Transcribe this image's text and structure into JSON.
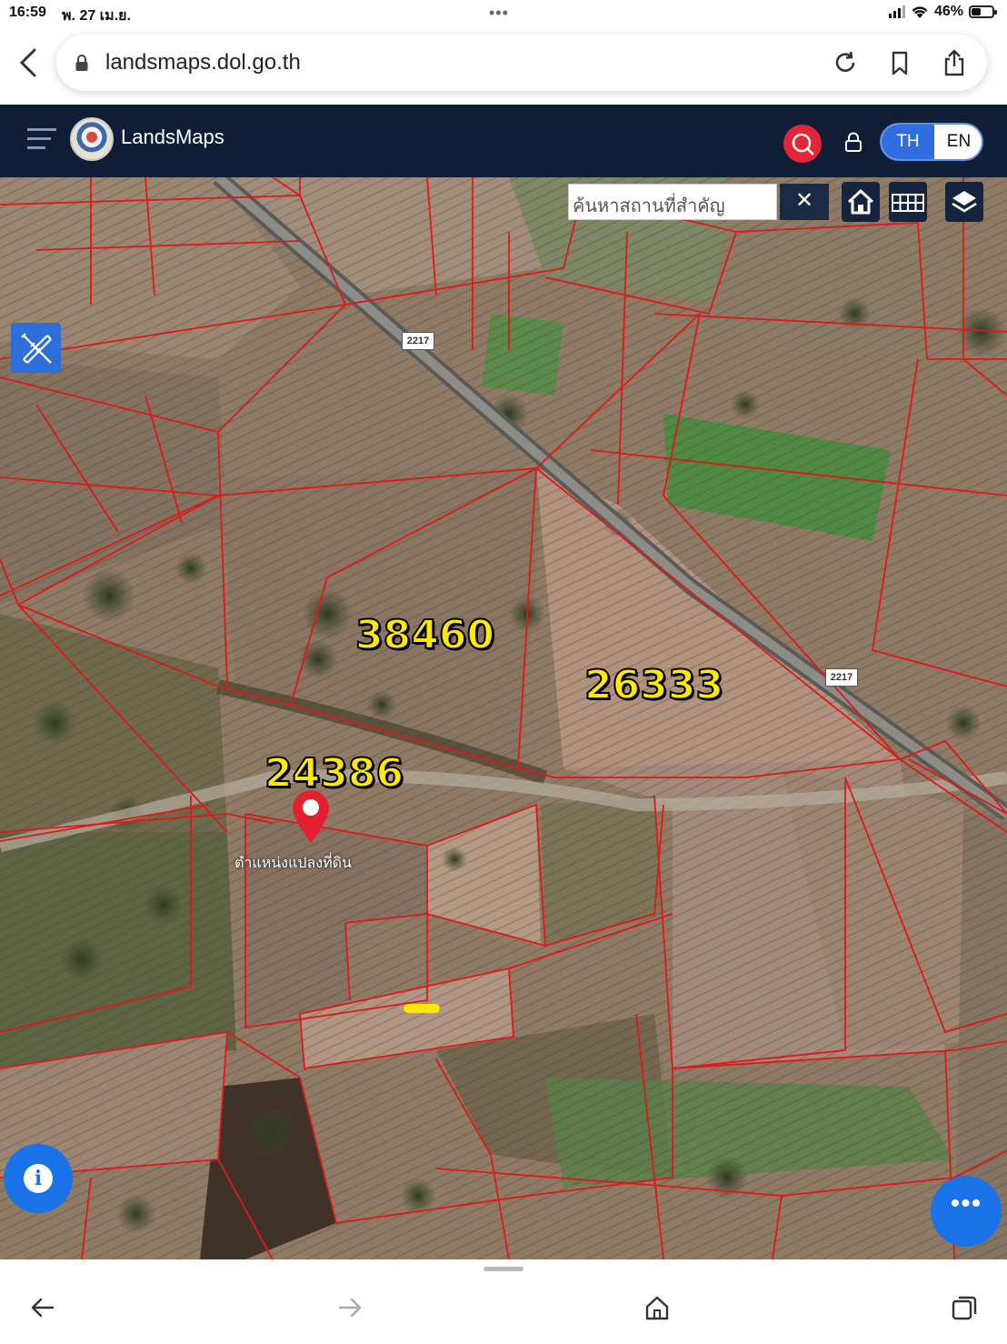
{
  "status": {
    "time": "16:59",
    "date": "พ. 27 เม.ย.",
    "battery_label": "46%",
    "battery_level": 0.46
  },
  "browser": {
    "url": "landsmaps.dol.go.th"
  },
  "app": {
    "brand": "LandsMaps",
    "lang_th": "TH",
    "lang_en": "EN",
    "search_placeholder": "ค้นหาสถานที่สำคัญ",
    "clear_label": "✕"
  },
  "map": {
    "parcels": [
      {
        "number": "38460"
      },
      {
        "number": "26333"
      },
      {
        "number": "24386"
      }
    ],
    "road_signs": [
      "2217",
      "2217"
    ],
    "pin_caption": "ตำแหน่งแปลงที่ดิน",
    "accent_boundary": "#e01818",
    "accent_label": "#ffea00"
  },
  "controls": {
    "info": "i",
    "more": "•••"
  }
}
